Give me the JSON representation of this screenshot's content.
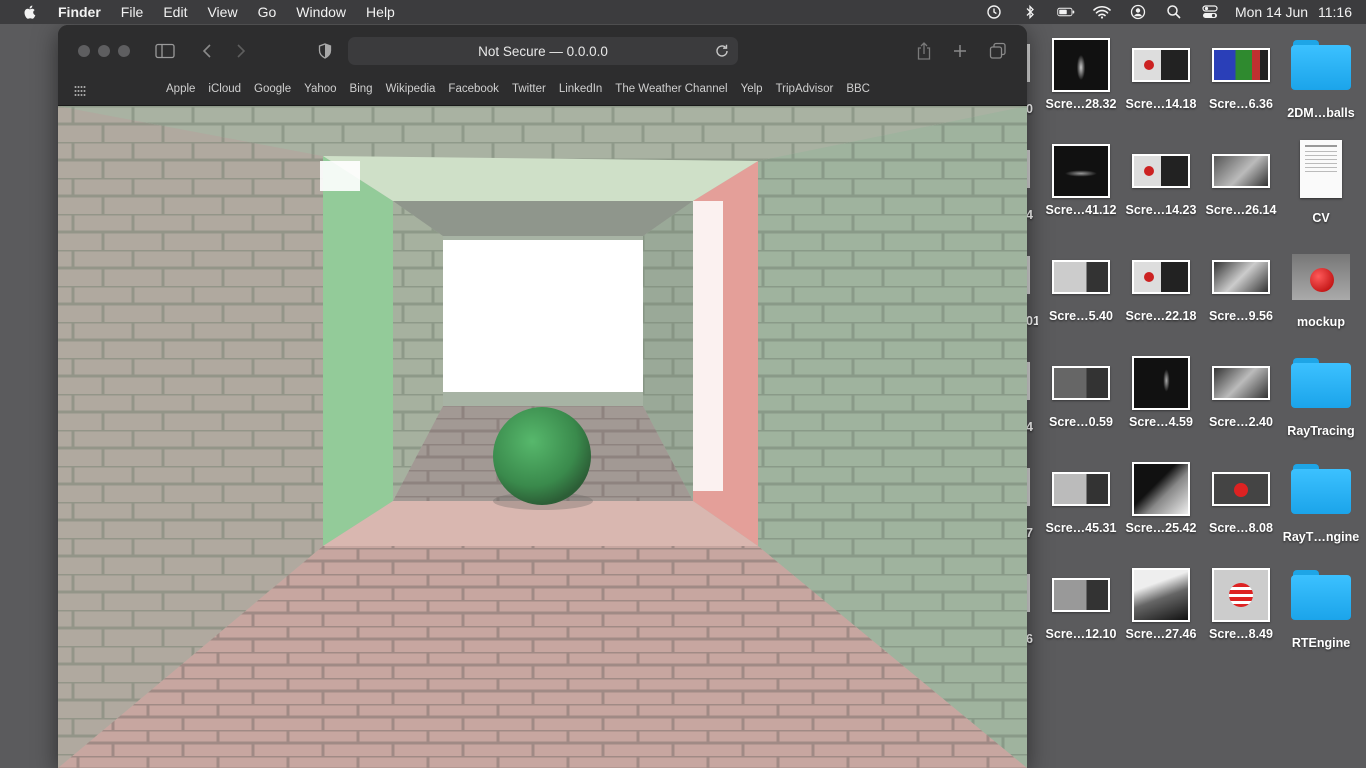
{
  "menubar": {
    "app": "Finder",
    "items": [
      "File",
      "Edit",
      "View",
      "Go",
      "Window",
      "Help"
    ],
    "clock_day": "Mon 14 Jun",
    "clock_time": "11:16"
  },
  "browser": {
    "address": "Not Secure — 0.0.0.0",
    "favorites": [
      "Apple",
      "iCloud",
      "Google",
      "Yahoo",
      "Bing",
      "Wikipedia",
      "Facebook",
      "Twitter",
      "LinkedIn",
      "The Weather Channel",
      "Yelp",
      "TripAdvisor",
      "BBC"
    ]
  },
  "desktop": {
    "partial_labels": [
      "0",
      "4",
      "01",
      "4",
      "7",
      "6"
    ],
    "rows": [
      [
        "Scre…28.32",
        "Scre…14.18",
        "Scre…6.36",
        "2DM…balls"
      ],
      [
        "Scre…41.12",
        "Scre…14.23",
        "Scre…26.14",
        "CV"
      ],
      [
        "Scre…5.40",
        "Scre…22.18",
        "Scre…9.56",
        "mockup"
      ],
      [
        "Scre…0.59",
        "Scre…4.59",
        "Scre…2.40",
        "RayTracing"
      ],
      [
        "Scre…45.31",
        "Scre…25.42",
        "Scre…8.08",
        "RayT…ngine"
      ],
      [
        "Scre…12.10",
        "Scre…27.46",
        "Scre…8.49",
        "RTEngine"
      ]
    ]
  },
  "colors": {
    "menubar": "#3c3c3e",
    "desktop": "#5b5b5d",
    "folder": "#2bb4f5",
    "wall_green": "#8fcf98",
    "wall_red": "#ef9b98",
    "sphere": "#3f9a55"
  }
}
